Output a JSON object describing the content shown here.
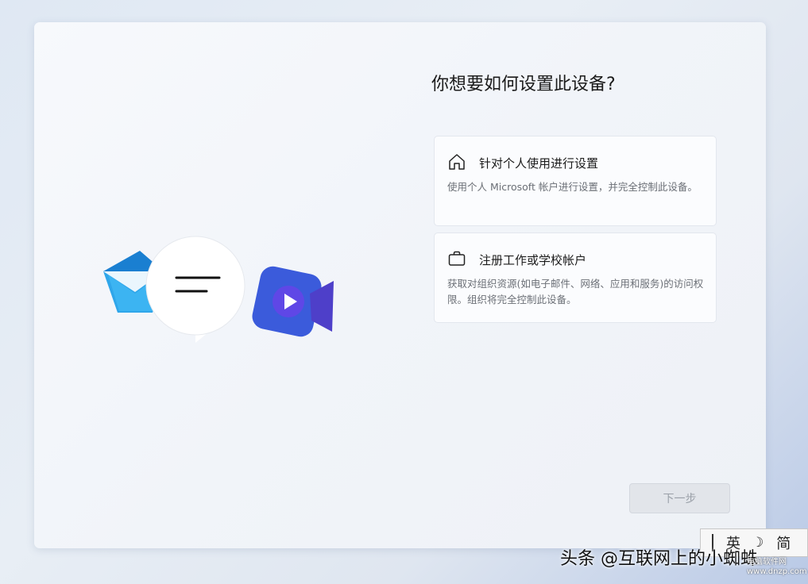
{
  "page": {
    "title": "你想要如何设置此设备?",
    "next_label": "下一步"
  },
  "options": [
    {
      "icon": "home-icon",
      "title": "针对个人使用进行设置",
      "description": "使用个人 Microsoft 帐户进行设置，并完全控制此设备。"
    },
    {
      "icon": "briefcase-icon",
      "title": "注册工作或学校帐户",
      "description": "获取对组织资源(如电子邮件、网络、应用和服务)的访问权限。组织将完全控制此设备。"
    }
  ],
  "ime": {
    "language": "英",
    "mode": "简"
  },
  "watermark": {
    "text": "头条 @互联网上的小蜘蛛",
    "site_name": "电脑软件网",
    "site_url": "www.dnzp.com"
  },
  "colors": {
    "mail_blue": "#1f8fd6",
    "video_indigo": "#3d4fd9",
    "button_disabled": "#e2e5ea"
  }
}
